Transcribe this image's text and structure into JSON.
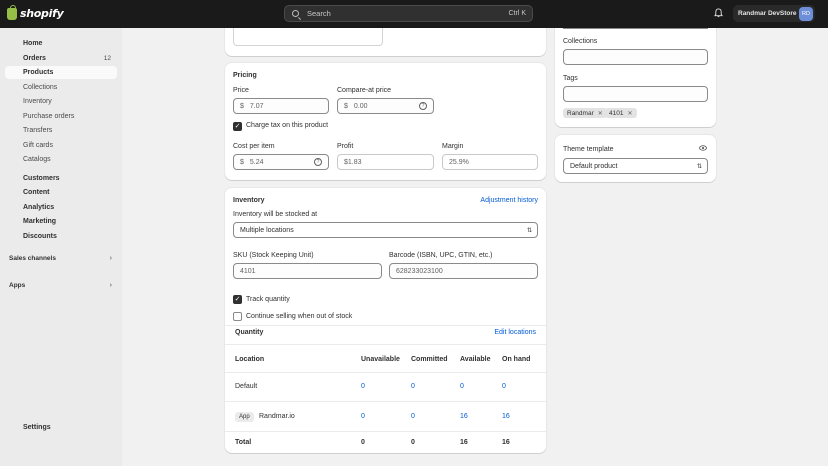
{
  "topbar": {
    "brand": "shopify",
    "search_placeholder": "Search",
    "search_shortcut": "Ctrl K",
    "store_name": "Randmar DevStore",
    "avatar_initials": "RD"
  },
  "sidebar": {
    "items": [
      {
        "label": "Home"
      },
      {
        "label": "Orders",
        "badge": "12"
      },
      {
        "label": "Products"
      },
      {
        "label": "Collections"
      },
      {
        "label": "Inventory"
      },
      {
        "label": "Purchase orders"
      },
      {
        "label": "Transfers"
      },
      {
        "label": "Gift cards"
      },
      {
        "label": "Catalogs"
      },
      {
        "label": "Customers"
      },
      {
        "label": "Content"
      },
      {
        "label": "Analytics"
      },
      {
        "label": "Marketing"
      },
      {
        "label": "Discounts"
      }
    ],
    "sales_channels": "Sales channels",
    "apps": "Apps",
    "settings": "Settings"
  },
  "pricing": {
    "title": "Pricing",
    "price_label": "Price",
    "price_value": "7.07",
    "compare_label": "Compare-at price",
    "compare_placeholder": "0.00",
    "currency": "$",
    "charge_tax_label": "Charge tax on this product",
    "cost_label": "Cost per item",
    "cost_value": "5.24",
    "profit_label": "Profit",
    "profit_value": "$1.83",
    "margin_label": "Margin",
    "margin_value": "25.9%"
  },
  "inventory": {
    "title": "Inventory",
    "adjustment_history": "Adjustment history",
    "stocked_at_label": "Inventory will be stocked at",
    "locations_select": "Multiple locations",
    "sku_label": "SKU (Stock Keeping Unit)",
    "sku_value": "4101",
    "barcode_label": "Barcode (ISBN, UPC, GTIN, etc.)",
    "barcode_value": "628233023100",
    "track_quantity_label": "Track quantity",
    "continue_selling_label": "Continue selling when out of stock",
    "quantity_title": "Quantity",
    "edit_locations": "Edit locations",
    "columns": [
      "Location",
      "Unavailable",
      "Committed",
      "Available",
      "On hand"
    ],
    "rows": [
      {
        "location": "Default",
        "app": "",
        "unavailable": "0",
        "committed": "0",
        "available": "0",
        "on_hand": "0"
      },
      {
        "location": "Randmar.io",
        "app": "App",
        "unavailable": "0",
        "committed": "0",
        "available": "16",
        "on_hand": "16"
      },
      {
        "location": "Total",
        "app": "",
        "unavailable": "0",
        "committed": "0",
        "available": "16",
        "on_hand": "16"
      }
    ]
  },
  "organization": {
    "collections_label": "Collections",
    "tags_label": "Tags",
    "tags": [
      "Randmar",
      "4101"
    ]
  },
  "theme": {
    "title": "Theme template",
    "value": "Default product"
  }
}
